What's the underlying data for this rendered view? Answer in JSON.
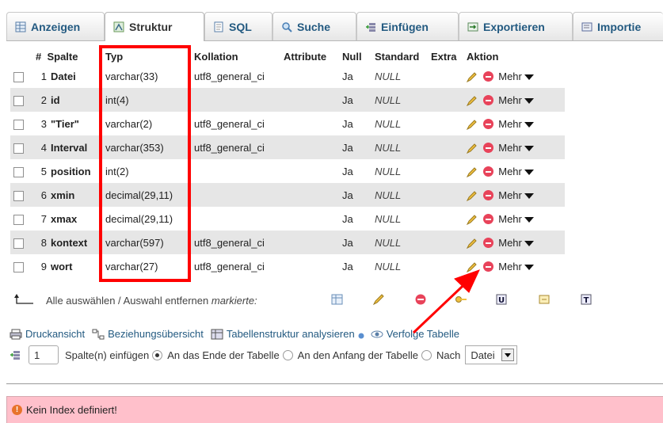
{
  "tabs": [
    {
      "label": "Anzeigen",
      "icon": "table-icon"
    },
    {
      "label": "Struktur",
      "icon": "structure-icon",
      "active": true
    },
    {
      "label": "SQL",
      "icon": "sql-icon"
    },
    {
      "label": "Suche",
      "icon": "search-icon"
    },
    {
      "label": "Einfügen",
      "icon": "insert-icon"
    },
    {
      "label": "Exportieren",
      "icon": "export-icon"
    },
    {
      "label": "Importie",
      "icon": "import-icon"
    }
  ],
  "table": {
    "headers": {
      "num": "#",
      "spalte": "Spalte",
      "typ": "Typ",
      "kollation": "Kollation",
      "attribute": "Attribute",
      "null": "Null",
      "standard": "Standard",
      "extra": "Extra",
      "aktion": "Aktion"
    },
    "rows": [
      {
        "num": "1",
        "name": "Datei",
        "type": "varchar(33)",
        "collation": "utf8_general_ci",
        "null": "Ja",
        "default": "NULL",
        "more": "Mehr"
      },
      {
        "num": "2",
        "name": "id",
        "type": "int(4)",
        "collation": "",
        "null": "Ja",
        "default": "NULL",
        "more": "Mehr"
      },
      {
        "num": "3",
        "name": "\"Tier\"",
        "type": "varchar(2)",
        "collation": "utf8_general_ci",
        "null": "Ja",
        "default": "NULL",
        "more": "Mehr"
      },
      {
        "num": "4",
        "name": "Interval",
        "type": "varchar(353)",
        "collation": "utf8_general_ci",
        "null": "Ja",
        "default": "NULL",
        "more": "Mehr"
      },
      {
        "num": "5",
        "name": "position",
        "type": "int(2)",
        "collation": "",
        "null": "Ja",
        "default": "NULL",
        "more": "Mehr"
      },
      {
        "num": "6",
        "name": "xmin",
        "type": "decimal(29,11)",
        "collation": "",
        "null": "Ja",
        "default": "NULL",
        "more": "Mehr"
      },
      {
        "num": "7",
        "name": "xmax",
        "type": "decimal(29,11)",
        "collation": "",
        "null": "Ja",
        "default": "NULL",
        "more": "Mehr"
      },
      {
        "num": "8",
        "name": "kontext",
        "type": "varchar(597)",
        "collation": "utf8_general_ci",
        "null": "Ja",
        "default": "NULL",
        "more": "Mehr"
      },
      {
        "num": "9",
        "name": "wort",
        "type": "varchar(27)",
        "collation": "utf8_general_ci",
        "null": "Ja",
        "default": "NULL",
        "more": "Mehr"
      }
    ]
  },
  "bulk": {
    "select_all": "Alle auswählen / Auswahl entfernen",
    "marked": "markierte:"
  },
  "links": {
    "print": "Druckansicht",
    "relations": "Beziehungsübersicht",
    "analyze": "Tabellenstruktur analysieren",
    "track": "Verfolge Tabelle"
  },
  "add": {
    "count": "1",
    "label": "Spalte(n) einfügen",
    "end": "An das Ende der Tabelle",
    "start": "An den Anfang der Tabelle",
    "after": "Nach",
    "after_select": "Datei"
  },
  "error": {
    "text": "Kein Index definiert!"
  },
  "colors": {
    "highlight": "#ff0000",
    "link": "#235a81",
    "error_bg": "#ffc0cb"
  }
}
